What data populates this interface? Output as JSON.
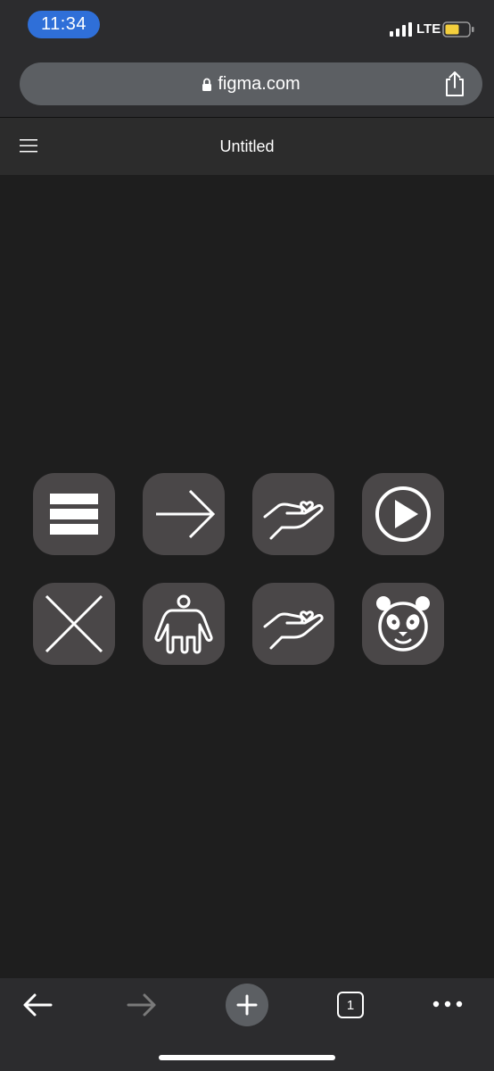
{
  "status_bar": {
    "time": "11:34",
    "carrier": "LTE",
    "accent_color": "#2f6fd8",
    "battery_color": "#f4cf3d"
  },
  "browser": {
    "url": "figma.com",
    "icons": [
      "lock-icon",
      "share-icon"
    ]
  },
  "app_header": {
    "title": "Untitled",
    "icons": [
      "menu-icon"
    ]
  },
  "canvas": {
    "tile_color": "#4a4748",
    "rows": [
      [
        "menu-bars-icon",
        "arrow-right-icon",
        "hand-heart-icon",
        "play-icon"
      ],
      [
        "close-x-icon",
        "person-icon",
        "hand-heart-icon",
        "panda-icon"
      ]
    ]
  },
  "toolbar": {
    "tabs_count": "1",
    "icons": [
      "back-arrow-icon",
      "forward-arrow-icon",
      "new-tab-plus-icon",
      "tabs-icon",
      "more-icon"
    ]
  }
}
